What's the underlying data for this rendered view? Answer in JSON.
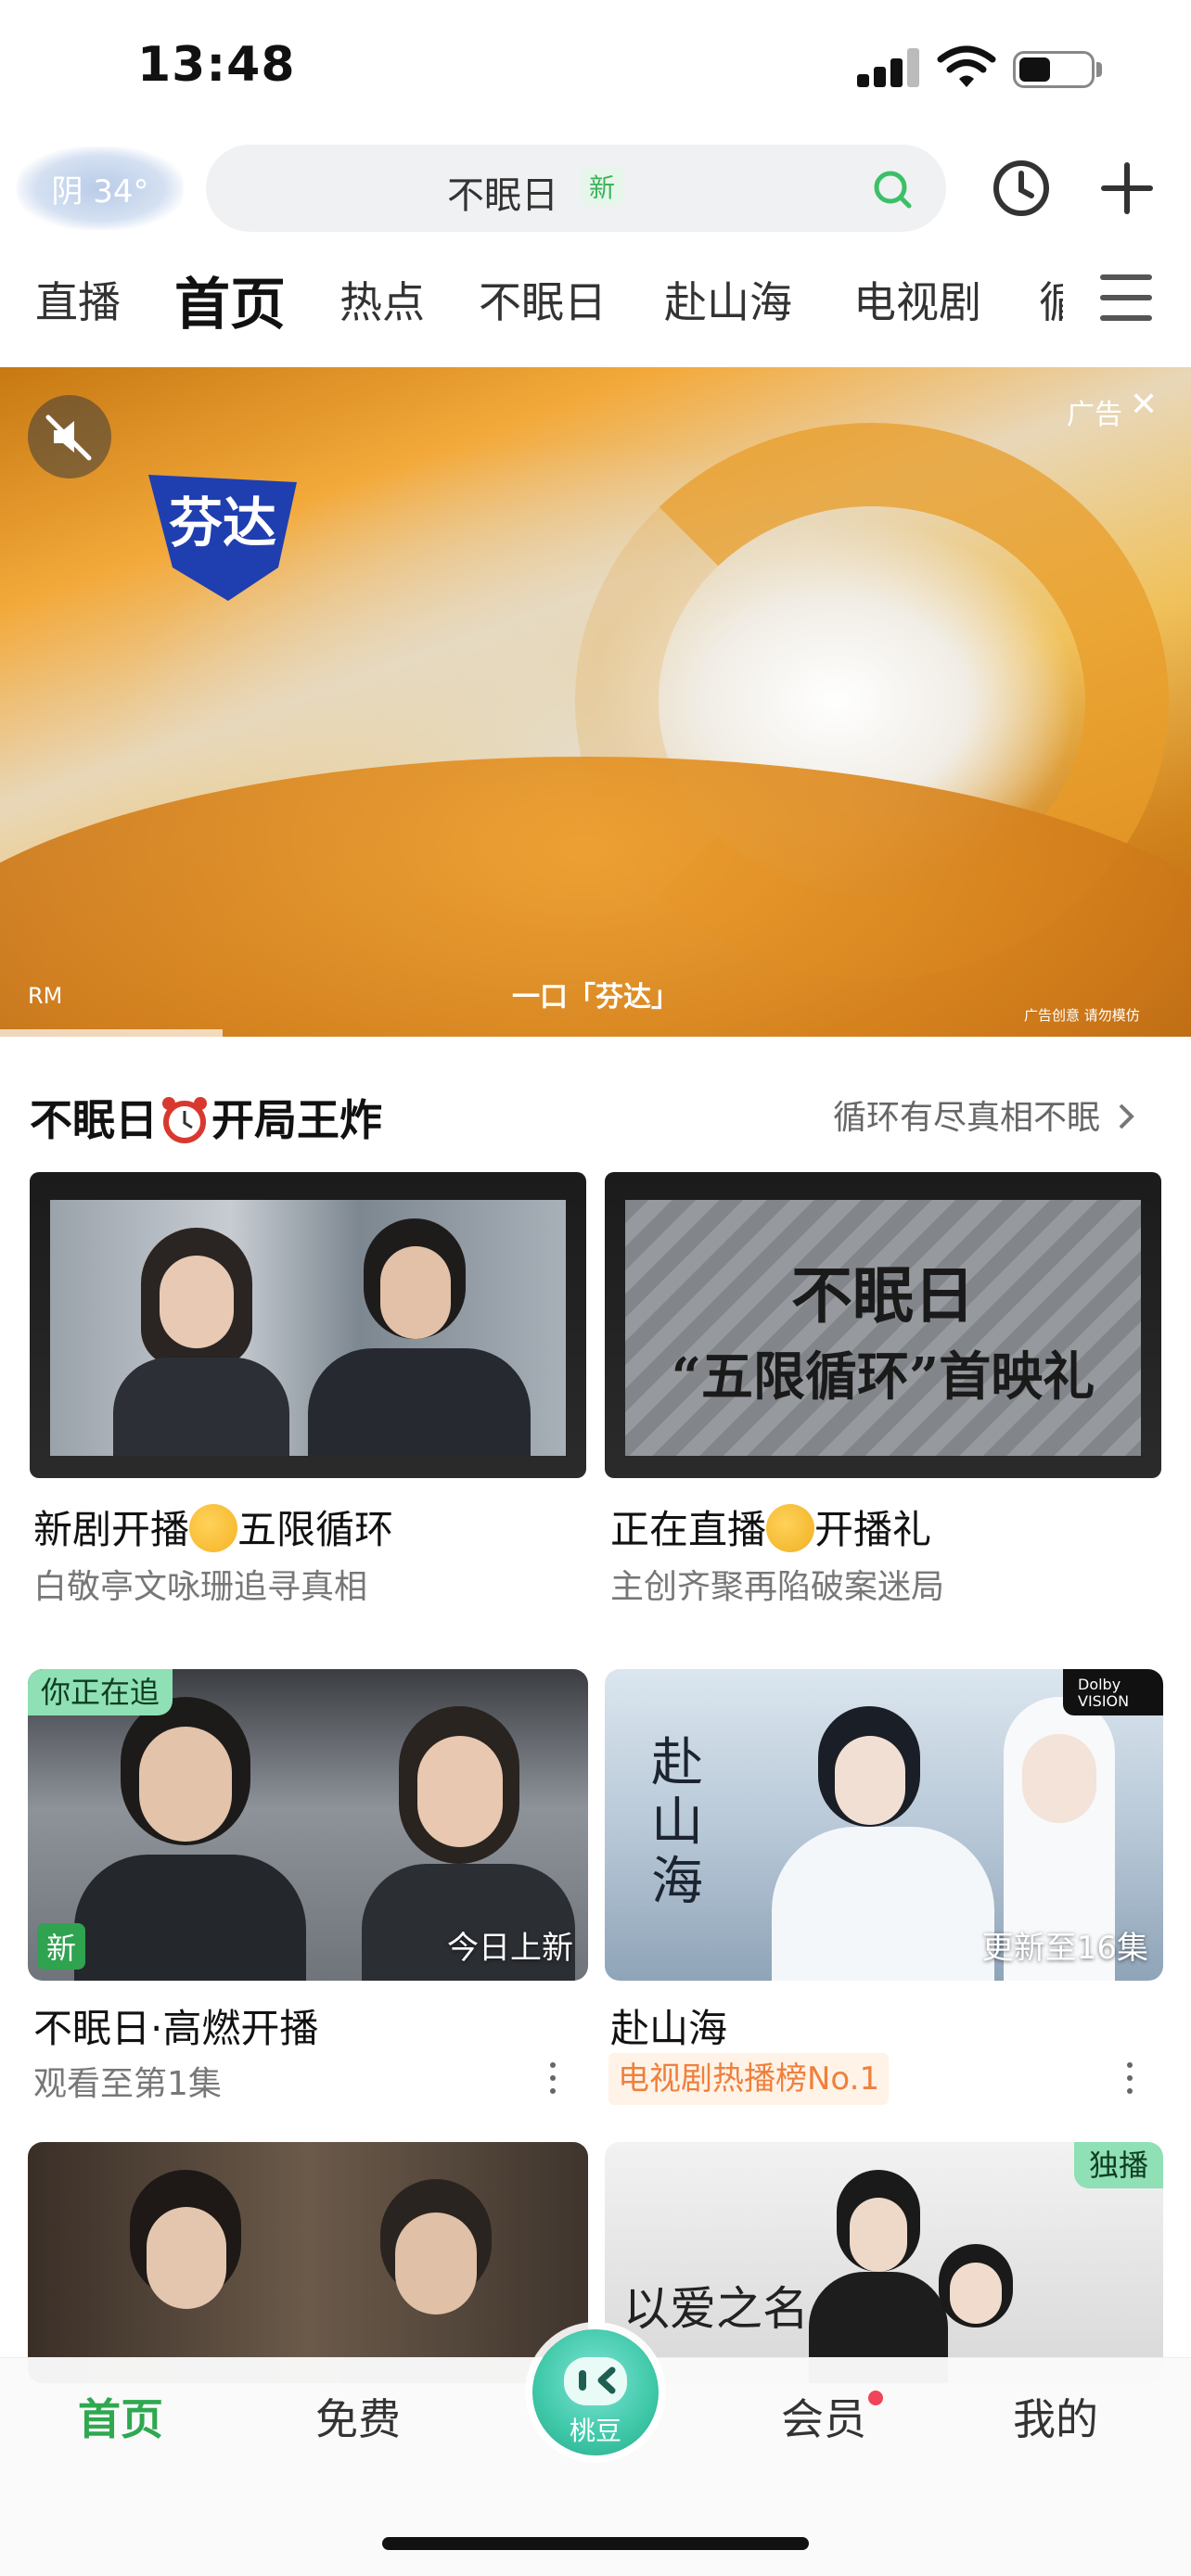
{
  "status_bar": {
    "time": "13:48",
    "battery_level": 0.45
  },
  "header": {
    "weather": "阴 34°",
    "search": {
      "text": "不眠日",
      "badge": "新"
    }
  },
  "tabs": [
    {
      "label": "直播"
    },
    {
      "label": "首页",
      "active": true
    },
    {
      "label": "热点"
    },
    {
      "label": "不眠日"
    },
    {
      "label": "赴山海"
    },
    {
      "label": "电视剧"
    },
    {
      "label": "循"
    }
  ],
  "ad": {
    "label": "广告",
    "close": "✕",
    "brand": "芬达",
    "caption": "一口「芬达」",
    "rm": "RM",
    "disclaimer": "广告创意 请勿模仿"
  },
  "section": {
    "title_part1": "不眠日",
    "title_part2": "开局王炸",
    "more": "循环有尽真相不眠"
  },
  "featured": [
    {
      "title_part1": "新剧开播",
      "title_part2": "五限循环",
      "subtitle": "白敬亭文咏珊追寻真相"
    },
    {
      "title_part1": "正在直播",
      "title_part2": "开播礼",
      "subtitle": "主创齐聚再陷破案迷局",
      "thumb_text1": "不眠日",
      "thumb_text2": "“五限循环”首映礼"
    }
  ],
  "grid": [
    {
      "title": "不眠日·高燃开播",
      "subtitle": "观看至第1集",
      "tag": "你正在追",
      "new_badge": "新",
      "overlay": "今日上新"
    },
    {
      "title": "赴山海",
      "rank": "电视剧热播榜No.1",
      "overlay": "更新至16集",
      "dolby_line1": "Dolby",
      "dolby_line2": "VISION",
      "thumb_text": "赴山海"
    },
    {
      "tag": ""
    },
    {
      "tag": "独播",
      "thumb_text": "以爱之名"
    }
  ],
  "bottom_nav": {
    "items": [
      "首页",
      "免费",
      "会员",
      "我的"
    ],
    "center_label": "桃豆"
  },
  "colors": {
    "accent": "#2fa84f",
    "rank": "#f0803c",
    "tag_green": "#8fe0b4"
  }
}
